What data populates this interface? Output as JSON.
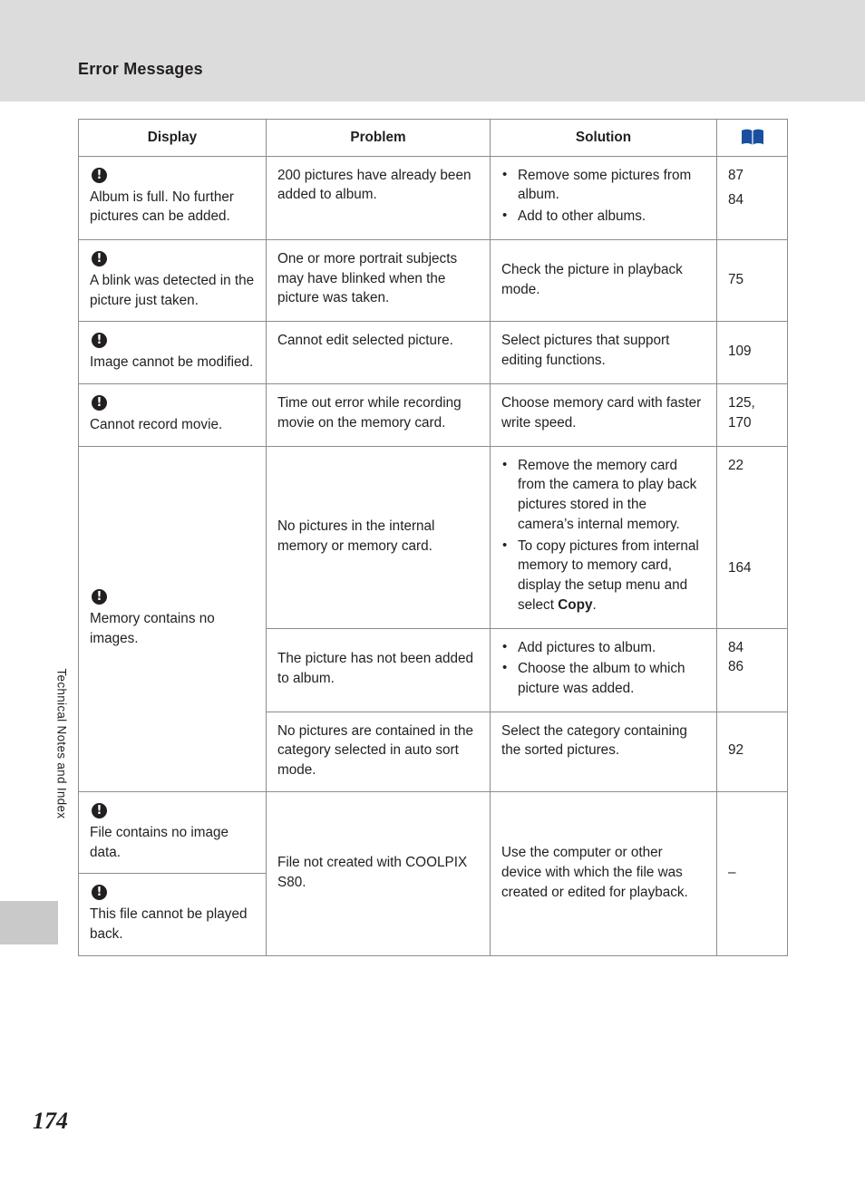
{
  "page": {
    "header_title": "Error Messages",
    "side_tab_label": "Technical Notes and Index",
    "page_number": "174"
  },
  "table": {
    "headers": {
      "display": "Display",
      "problem": "Problem",
      "solution": "Solution",
      "page_icon": "book-icon"
    },
    "rows": [
      {
        "icon": "!",
        "display": "Album is full. No further pictures can be added.",
        "problem": "200 pictures have already been added to album.",
        "solution_bullets": [
          "Remove some pictures from album.",
          "Add to other albums."
        ],
        "pages": [
          "87",
          "84"
        ]
      },
      {
        "icon": "!",
        "display": "A blink was detected in the picture just taken.",
        "problem": "One or more portrait subjects may have blinked when the picture was taken.",
        "solution": "Check the picture in playback mode.",
        "pages": [
          "75"
        ]
      },
      {
        "icon": "!",
        "display": "Image cannot be modified.",
        "problem": "Cannot edit selected picture.",
        "solution": "Select pictures that support editing functions.",
        "pages": [
          "109"
        ]
      },
      {
        "icon": "!",
        "display": "Cannot record movie.",
        "problem": "Time out error while recording movie on the memory card.",
        "solution": "Choose memory card with faster write speed.",
        "pages": [
          "125,",
          "170"
        ]
      },
      {
        "icon": "!",
        "display": "Memory contains no images.",
        "sub_rows": [
          {
            "problem": "No pictures in the internal memory or memory card.",
            "solution_bullets": [
              "Remove the memory card from the camera to play back pictures stored in the camera’s internal memory.",
              "To copy pictures from internal memory to memory card, display the setup menu and select Copy."
            ],
            "solution_bold_word": "Copy",
            "pages": [
              "22",
              "164"
            ]
          },
          {
            "problem": "The picture has not been added to album.",
            "solution_bullets": [
              "Add pictures to album.",
              "Choose the album to which picture was added."
            ],
            "pages": [
              "84",
              "86"
            ]
          },
          {
            "problem": "No pictures are contained in the category selected in auto sort mode.",
            "solution": "Select the category containing the sorted pictures.",
            "pages": [
              "92"
            ]
          }
        ]
      },
      {
        "display_group": [
          {
            "icon": "!",
            "display": "File contains no image data."
          },
          {
            "icon": "!",
            "display": "This file cannot be played back."
          }
        ],
        "problem": "File not created with COOLPIX S80.",
        "solution": "Use the computer or other device with which the file was created or edited for playback.",
        "pages": [
          "–"
        ]
      }
    ]
  }
}
